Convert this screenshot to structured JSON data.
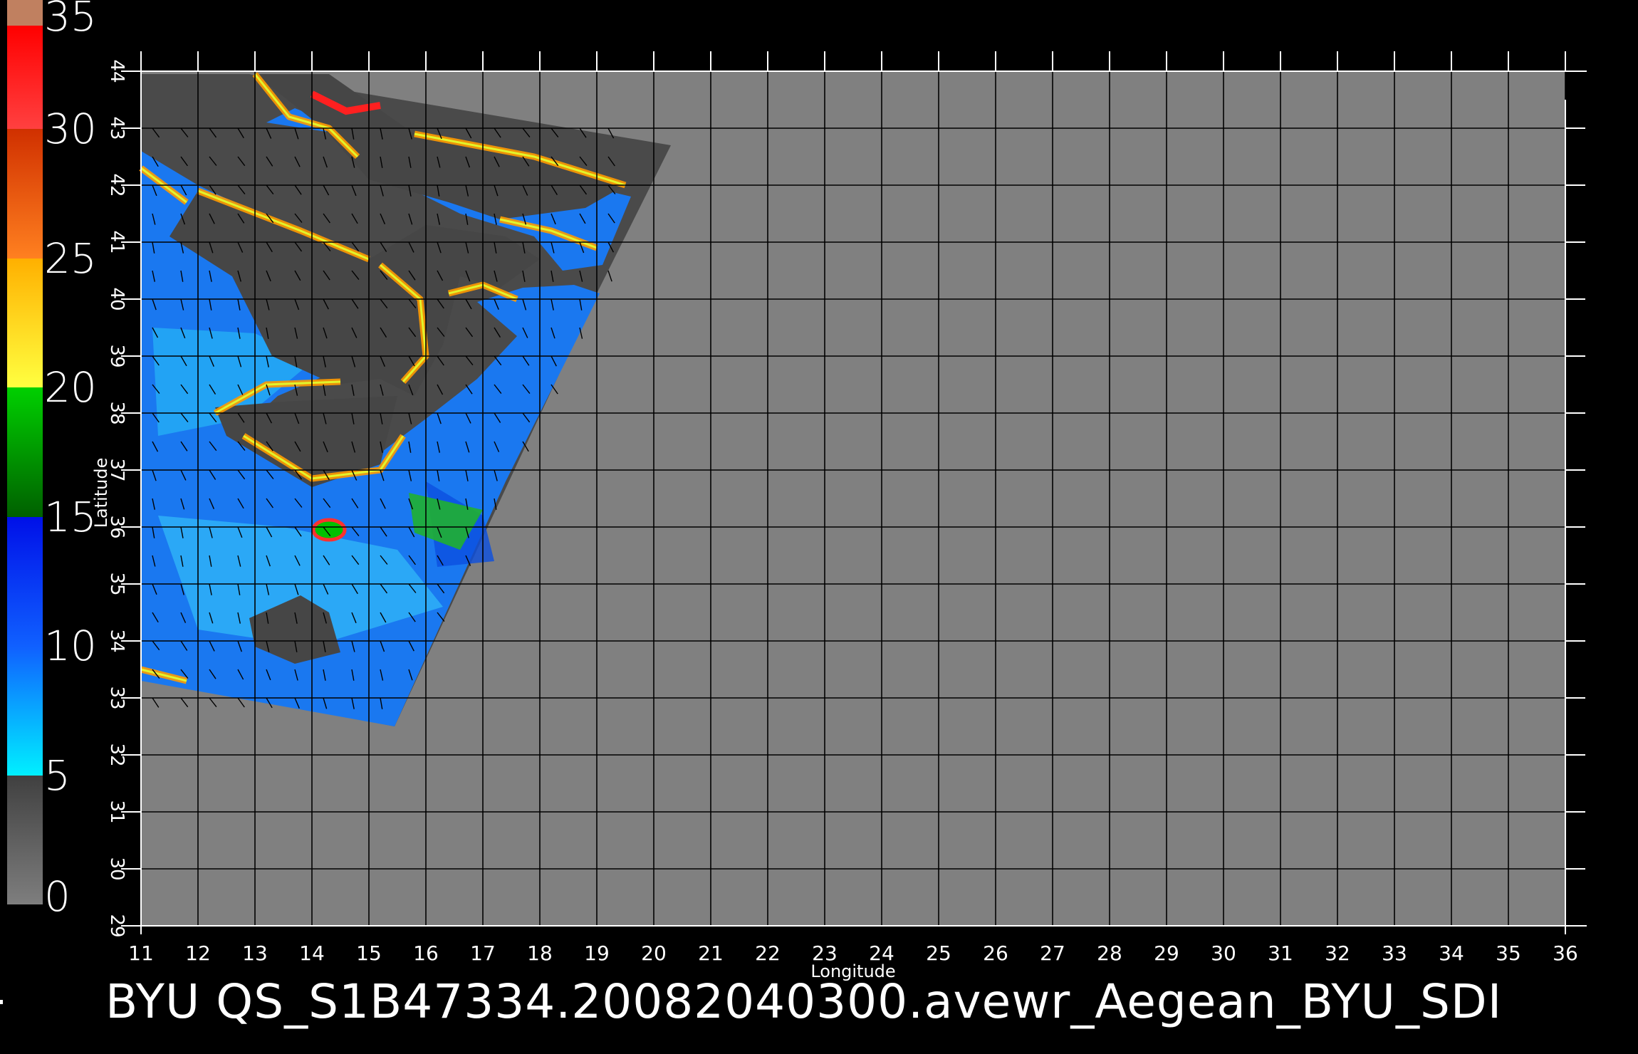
{
  "colorbar": {
    "labels": [
      "35",
      "30",
      "25",
      "20",
      "15",
      "10",
      "5",
      "0"
    ],
    "bands": [
      {
        "from": 0,
        "to": 5,
        "colors": [
          "#7e7e7e",
          "#404040"
        ]
      },
      {
        "from": 5,
        "to": 15,
        "colors": [
          "#00f0ff",
          "#1060ff",
          "#0010e8"
        ]
      },
      {
        "from": 15,
        "to": 20,
        "colors": [
          "#006000",
          "#00d000"
        ]
      },
      {
        "from": 20,
        "to": 25,
        "colors": [
          "#ffff40",
          "#ffb000"
        ]
      },
      {
        "from": 25,
        "to": 30,
        "colors": [
          "#ff8020",
          "#d03000"
        ]
      },
      {
        "from": 30,
        "to": 34,
        "colors": [
          "#ff4040",
          "#ff0000"
        ]
      },
      {
        "from": 34,
        "to": 35,
        "colors": [
          "#c08060",
          "#c08060"
        ]
      }
    ]
  },
  "map": {
    "x_ticks": [
      "11",
      "12",
      "13",
      "14",
      "15",
      "16",
      "17",
      "18",
      "19",
      "20",
      "21",
      "22",
      "23",
      "24",
      "25",
      "26",
      "27",
      "28",
      "29",
      "30",
      "31",
      "32",
      "33",
      "34",
      "35",
      "36"
    ],
    "y_ticks": [
      "29",
      "30",
      "31",
      "32",
      "33",
      "34",
      "35",
      "36",
      "37",
      "38",
      "39",
      "40",
      "41",
      "42",
      "43",
      "44"
    ],
    "xlabel": "Longitude",
    "ylabel": "Latitude",
    "lon_range": [
      11,
      36
    ],
    "lat_range": [
      29,
      44
    ],
    "background_color": "#808080",
    "swath_color": "#4a4a4a",
    "land_color": "#464646",
    "grid": true
  },
  "title": "BYU  QS_S1B47334.20082040300.avewr_Aegean_BYU_SDI"
}
